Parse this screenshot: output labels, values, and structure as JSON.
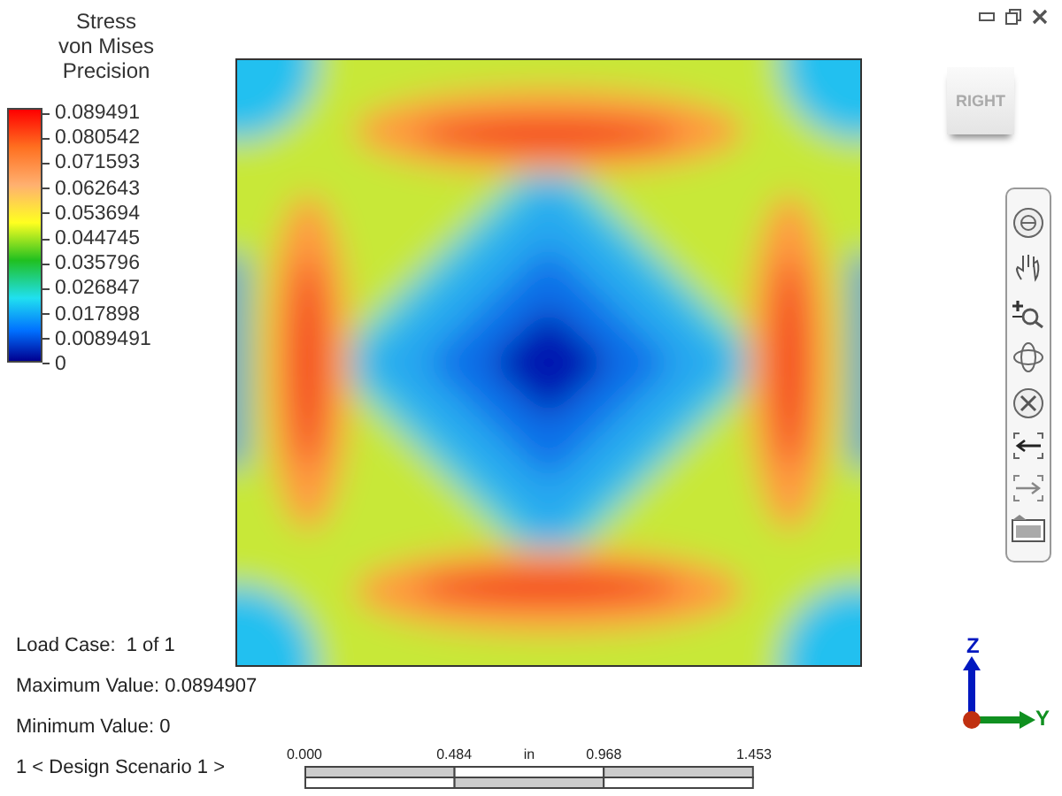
{
  "legend": {
    "title_lines": [
      "Stress",
      "von Mises",
      "Precision"
    ],
    "ticks": [
      "0.089491",
      "0.080542",
      "0.071593",
      "0.062643",
      "0.053694",
      "0.044745",
      "0.035796",
      "0.026847",
      "0.017898",
      "0.0089491",
      "0"
    ]
  },
  "view_cube": {
    "label": "RIGHT"
  },
  "axes": {
    "z": "Z",
    "y": "Y"
  },
  "info": [
    "Load Case:  1 of 1",
    "Maximum Value: 0.0894907",
    "Minimum Value: 0",
    "1 < Design Scenario 1 >"
  ],
  "scale_bar": {
    "ticks": [
      "0.000",
      "0.484",
      "0.968",
      "1.453"
    ],
    "unit": "in"
  }
}
